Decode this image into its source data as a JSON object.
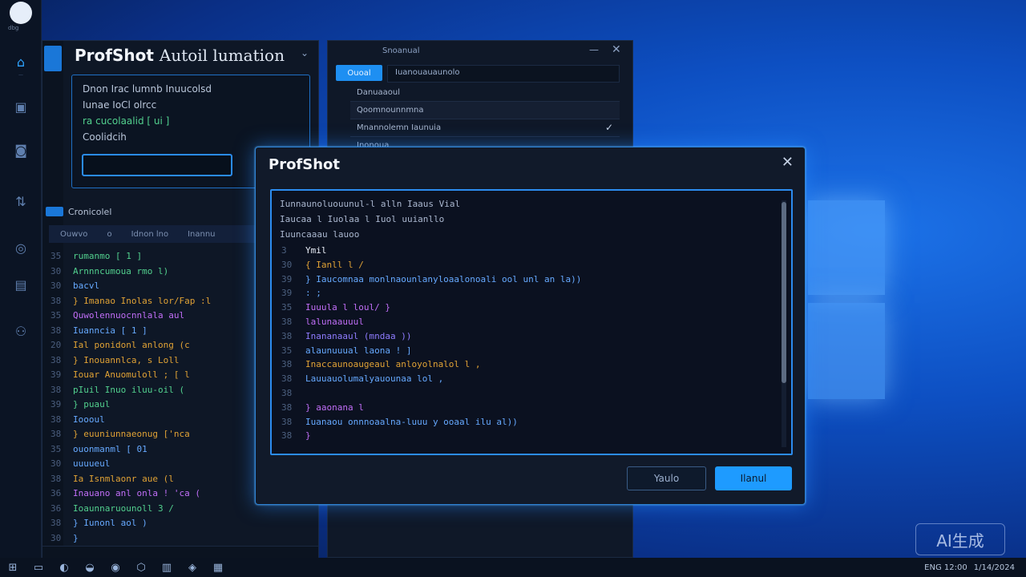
{
  "app": {
    "main_title": "ProfShot",
    "main_subtitle": "Autoil lumation",
    "dialog_title": "ProfShot"
  },
  "rail": {
    "items": [
      {
        "icon": "home-icon",
        "label": "—"
      },
      {
        "icon": "gamepad-icon",
        "label": ""
      },
      {
        "icon": "chat-icon",
        "label": ""
      },
      {
        "icon": "share-icon",
        "label": ""
      },
      {
        "icon": "globe-icon",
        "label": ""
      },
      {
        "icon": "document-icon",
        "label": ""
      },
      {
        "icon": "users-icon",
        "label": ""
      }
    ]
  },
  "main": {
    "info_lines": [
      "Dnon Irac lumnb Inuucolsd",
      "Iunae IoCl olrcc",
      "ra  cucolaalid [ ui ]",
      "Coolidcih"
    ],
    "panel_title": "Cronicolel",
    "columns": [
      "Ouwvo",
      "o",
      "Idnon lno",
      "Inannu"
    ],
    "code": [
      {
        "ln": "35",
        "text": "  rumanmo [ 1 ]"
      },
      {
        "ln": "30",
        "text": "  Arnnncumoua rmo l)"
      },
      {
        "ln": "30",
        "text": "      bacvl"
      },
      {
        "ln": "38",
        "text": "    } Imanao Inolas lor/Fap :l"
      },
      {
        "ln": "35",
        "text": "      Quwolennuocnnlala aul"
      },
      {
        "ln": "38",
        "text": "      Iuanncia [ 1 ]"
      },
      {
        "ln": "20",
        "text": "      Ial ponidonl anlong (c"
      },
      {
        "ln": "38",
        "text": "        } Inouannlca, s Loll"
      },
      {
        "ln": "39",
        "text": "        Iouar Anuomuloll ; [ l"
      },
      {
        "ln": "38",
        "text": "      pIuil Inuo iluu-oil ("
      },
      {
        "ln": "39",
        "text": "      }  puaul"
      },
      {
        "ln": "38",
        "text": "  Ioooul"
      },
      {
        "ln": "38",
        "text": "  } euuniunnaeonug ['nca"
      },
      {
        "ln": "35",
        "text": "      ouonmanml [ 01"
      },
      {
        "ln": "30",
        "text": "      uuuueul"
      },
      {
        "ln": "38",
        "text": "      Ia Isnmlaonr aue (l"
      },
      {
        "ln": "36",
        "text": "      Inauano anl onla ! 'ca ("
      },
      {
        "ln": "36",
        "text": "      Ioaunnaruounoll 3 /"
      },
      {
        "ln": "38",
        "text": "    } Iunonl aol )"
      },
      {
        "ln": "30",
        "text": "  }"
      },
      {
        "ln": "38",
        "text": "}"
      }
    ]
  },
  "settings": {
    "title": "Snoanual",
    "tab_label": "Ouoal",
    "tab_field": "Iuanouauaunolo",
    "rows": [
      "Danuaaoul",
      "Qoomnounnmna",
      "Mnannolemn Iaunuia",
      "Inonoua"
    ]
  },
  "dialog": {
    "header_lines": [
      "Iunnaunoluouunul-l alln Iaaus Vial",
      "Iaucaa l Iuolaa l Iuol uuianllo",
      "Iuuncaaau lauoo"
    ],
    "code": [
      {
        "ln": "3",
        "text": "Ymil",
        "color": "#e9eef7"
      },
      {
        "ln": "30",
        "text": "  { Ianll l /",
        "color": "#e0a235"
      },
      {
        "ln": "39",
        "text": "    } Iaucomnaa monlnaounlanyloaalonoali ool unl an la))",
        "color": "#66a9ff"
      },
      {
        "ln": "39",
        "text": "    :   ;",
        "color": "#66a9ff"
      },
      {
        "ln": "35",
        "text": "      Iuuula l loul/ }",
        "color": "#c06ef7"
      },
      {
        "ln": "38",
        "text": "      lalunaauuul",
        "color": "#c06ef7"
      },
      {
        "ln": "38",
        "text": "        Inananaaul (mndaa ))",
        "color": "#8f7cff"
      },
      {
        "ln": "35",
        "text": "          alaunuuual laona ! ]",
        "color": "#66a9ff"
      },
      {
        "ln": "38",
        "text": "            Inaccaunoaugeaul anloyolnalol l ,",
        "color": "#e0a235"
      },
      {
        "ln": "38",
        "text": "            Lauuauolumalyauounaa lol ,",
        "color": "#66a9ff"
      },
      {
        "ln": "38",
        "text": "",
        "color": "#66a9ff"
      },
      {
        "ln": "38",
        "text": "      } aaonana l",
        "color": "#c06ef7"
      },
      {
        "ln": "38",
        "text": "      Iuanaou onnnoaalna-luuu y ooaal ilu al))",
        "color": "#66a9ff"
      },
      {
        "ln": "38",
        "text": "  }",
        "color": "#c06ef7"
      }
    ],
    "secondary_button": "Yaulo",
    "primary_button": "Ilanul"
  },
  "taskbar": {
    "icons": [
      "windows-icon",
      "files-icon",
      "browser-icon",
      "edge-icon",
      "store-icon",
      "shield-icon",
      "photos-icon",
      "terminal-icon",
      "notepad-icon"
    ],
    "tray_text": "ENG   12:00  ",
    "clock": "1/14/2024"
  },
  "watermark": "AI生成"
}
